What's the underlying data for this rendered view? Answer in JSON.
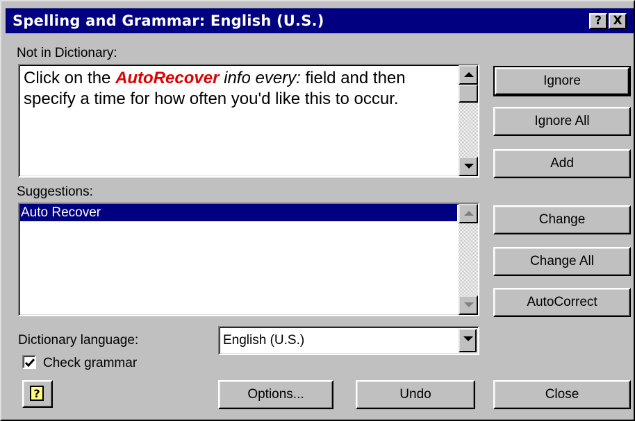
{
  "window": {
    "title": "Spelling and Grammar: English (U.S.)",
    "help_button": "?",
    "close_button": "X"
  },
  "not_in_dictionary": {
    "label": "Not in Dictionary:",
    "sentence_before": "Click on the ",
    "flagged_word": "AutoRecover",
    "sentence_italic": " info every:",
    "sentence_after": " field and then specify a time for how often you'd like this to occur.",
    "flagged_color": "#e00000"
  },
  "suggestions": {
    "label": "Suggestions:",
    "items": [
      "Auto Recover"
    ],
    "selected_index": 0
  },
  "dictionary_language": {
    "label": "Dictionary language:",
    "value": "English (U.S.)"
  },
  "check_grammar": {
    "label": "Check grammar",
    "checked": true
  },
  "buttons": {
    "ignore": "Ignore",
    "ignore_all": "Ignore All",
    "add": "Add",
    "change": "Change",
    "change_all": "Change All",
    "autocorrect": "AutoCorrect",
    "options": "Options...",
    "undo": "Undo",
    "close": "Close"
  },
  "icons": {
    "assistant": "office-assistant-help-icon",
    "scroll_up": "arrow-up-icon",
    "scroll_down": "arrow-down-icon",
    "combo": "chevron-down-icon"
  },
  "colors": {
    "title_bar": "#000080",
    "selection": "#000080",
    "face": "#c0c0c0"
  }
}
